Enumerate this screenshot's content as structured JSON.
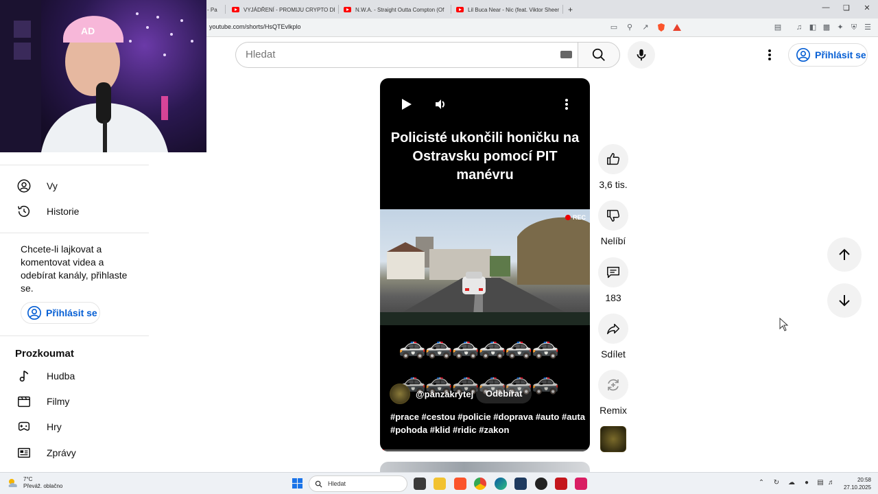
{
  "browser": {
    "tabs": [
      {
        "label": "- Pa"
      },
      {
        "label": "VYJÁDŘENÍ - PROMIJU CRYPTO DĚT"
      },
      {
        "label": "N.W.A. - Straight Outta Compton (Of"
      },
      {
        "label": "Lil Buca Near - Nic (feat. Viktor Sheen"
      }
    ],
    "new_tab": "+",
    "url": "youtube.com/shorts/HsQTEvlkplo"
  },
  "header": {
    "search_placeholder": "Hledat",
    "signin_label": "Přihlásit se"
  },
  "sidebar": {
    "items_top": [
      {
        "label": "Vy",
        "icon": "account-icon"
      },
      {
        "label": "Historie",
        "icon": "history-icon"
      }
    ],
    "signin_note": "Chcete-li lajkovat a komentovat videa a odebírat kanály, přihlaste se.",
    "signin_label": "Přihlásit se",
    "explore_heading": "Prozkoumat",
    "explore_items": [
      {
        "label": "Hudba",
        "icon": "music-icon"
      },
      {
        "label": "Filmy",
        "icon": "film-icon"
      },
      {
        "label": "Hry",
        "icon": "gamepad-icon"
      },
      {
        "label": "Zprávy",
        "icon": "news-icon"
      }
    ]
  },
  "short": {
    "title": "Policisté ukončili honičku na Ostravsku pomocí PIT manévru",
    "rec_label": "REC",
    "cars_row": "🚓🚓🚓🚓🚓🚓",
    "channel": "@panzakrytej",
    "subscribe_label": "Odebírat",
    "description": "#prace #cestou #policie #doprava #auto #auta #pohoda #klid #ridic #zakon",
    "progress": 0.02
  },
  "actions": {
    "likes": "3,6 tis.",
    "dislike_label": "Nelíbí",
    "comments": "183",
    "share_label": "Sdílet",
    "remix_label": "Remix"
  },
  "taskbar": {
    "weather_temp": "7°C",
    "weather_desc": "Převáž. oblačno",
    "search_label": "Hledat",
    "time": "20:58",
    "date": "27.10.2025"
  },
  "colors": {
    "accent_blue": "#065fd4",
    "youtube_red": "#ff0000"
  }
}
